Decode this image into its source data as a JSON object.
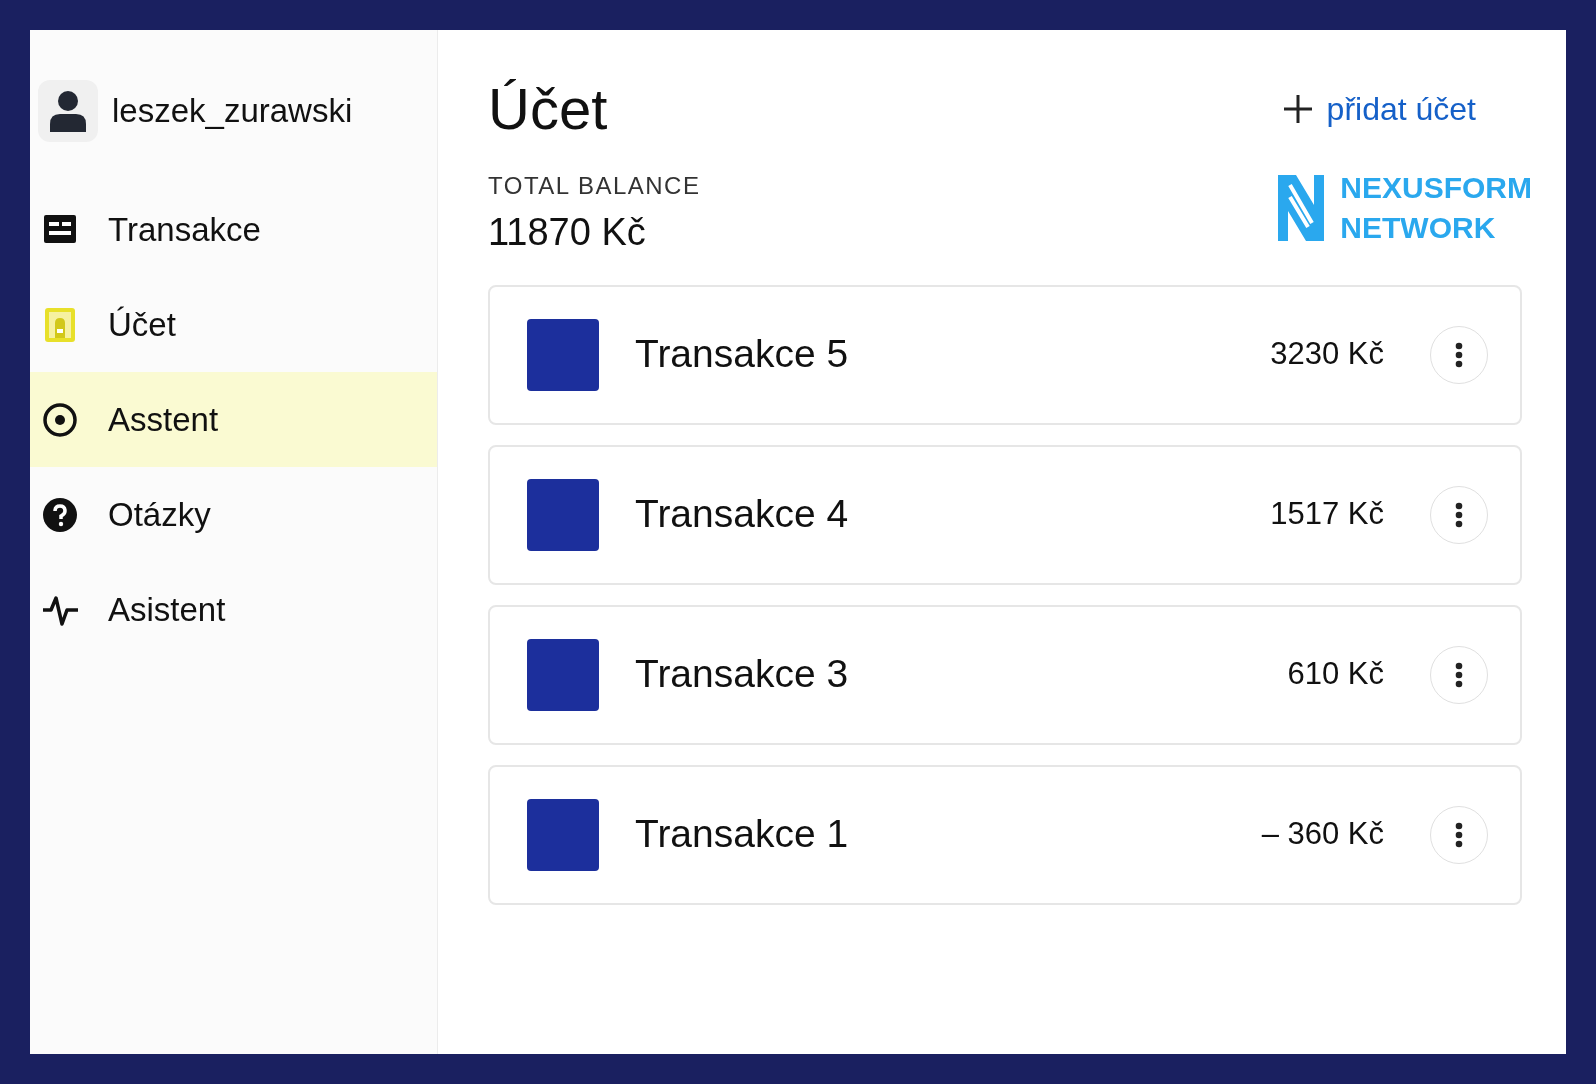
{
  "user": {
    "name": "leszek_zurawski"
  },
  "sidebar": {
    "items": [
      {
        "label": "Transakce",
        "kind": "list",
        "selected": false
      },
      {
        "label": "Účet",
        "kind": "card",
        "selected": false
      },
      {
        "label": "Asstent",
        "kind": "target",
        "selected": true
      },
      {
        "label": "Otázky",
        "kind": "help",
        "selected": false
      },
      {
        "label": "Asistent",
        "kind": "pulse",
        "selected": false
      }
    ]
  },
  "page": {
    "title": "Účet",
    "add_link": "přidat účet"
  },
  "logo": {
    "lines": [
      "NEXUSFORM",
      "NETWORK"
    ]
  },
  "balance": {
    "label": "TOTAL BALANCE",
    "amount": "11870 Kč"
  },
  "transactions": [
    {
      "name": "Transakce 5",
      "amount": "3230 Kč"
    },
    {
      "name": "Transakce 4",
      "amount": "1517 Kč"
    },
    {
      "name": "Transakce 3",
      "amount": "610 Kč"
    },
    {
      "name": "Transakce 1",
      "amount": "– 360 Kč"
    }
  ]
}
